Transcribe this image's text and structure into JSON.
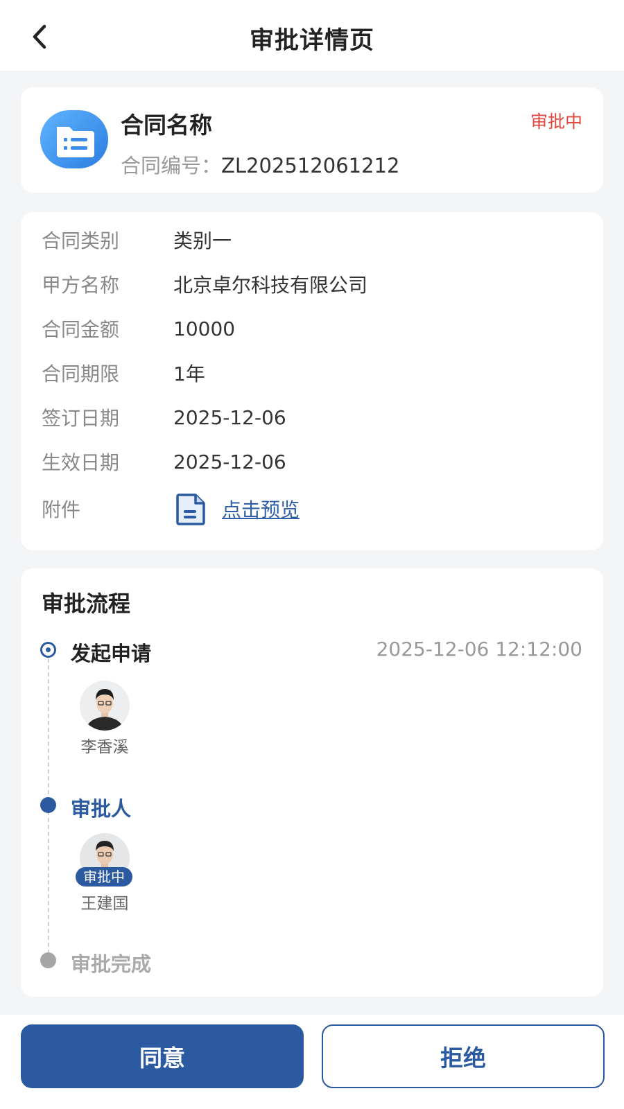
{
  "header": {
    "title": "审批详情页"
  },
  "contract": {
    "name": "合同名称",
    "number_label": "合同编号：",
    "number_value": "ZL202512061212",
    "status": "审批中"
  },
  "details": [
    {
      "label": "合同类别",
      "value": "类别一"
    },
    {
      "label": "甲方名称",
      "value": "北京卓尔科技有限公司"
    },
    {
      "label": "合同金额",
      "value": "10000"
    },
    {
      "label": "合同期限",
      "value": "1年"
    },
    {
      "label": "签订日期",
      "value": "2025-12-06"
    },
    {
      "label": "生效日期",
      "value": "2025-12-06"
    }
  ],
  "attachment": {
    "label": "附件",
    "link_text": "点击预览"
  },
  "flow": {
    "title": "审批流程",
    "steps": [
      {
        "title": "发起申请",
        "time": "2025-12-06 12:12:00",
        "person": "李香溪"
      },
      {
        "title": "审批人",
        "person": "王建国",
        "tag": "审批中"
      },
      {
        "title": "审批完成"
      }
    ]
  },
  "actions": {
    "agree": "同意",
    "reject": "拒绝"
  },
  "colors": {
    "primary": "#2b5aa0",
    "status_red": "#e0463c"
  }
}
